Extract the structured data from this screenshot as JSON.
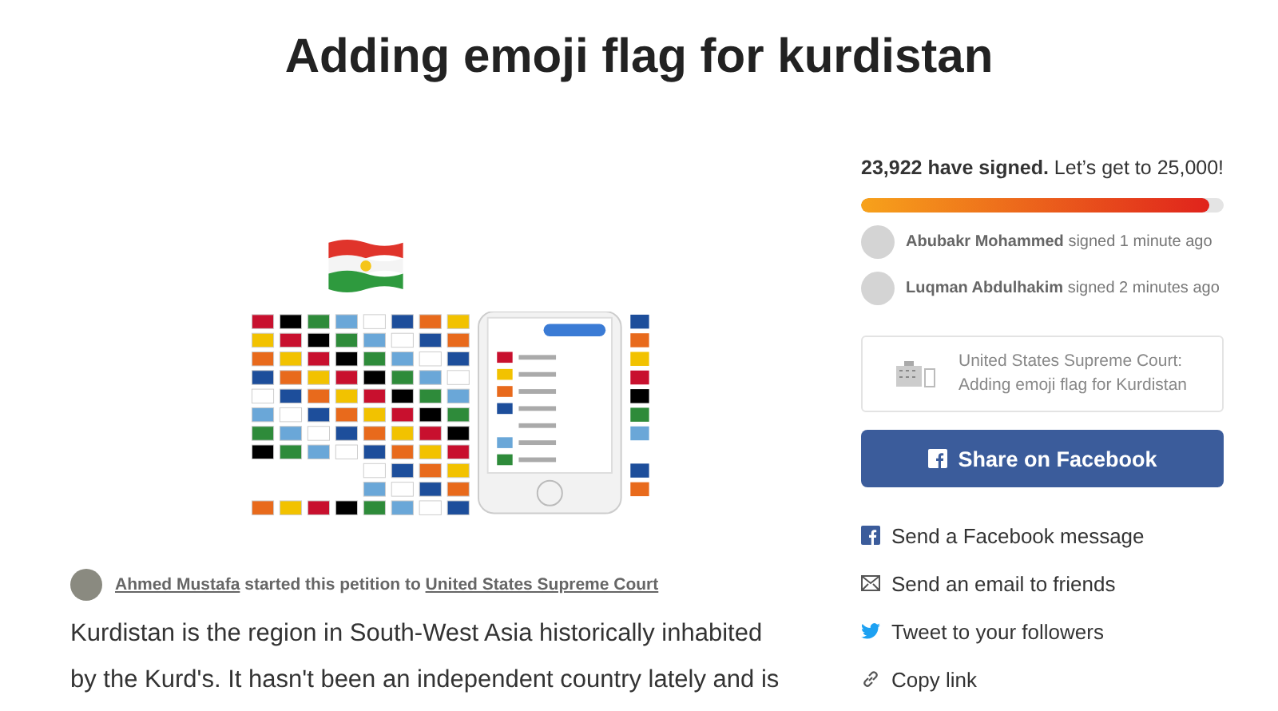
{
  "title": "Adding emoji flag for kurdistan",
  "signatures": {
    "count": "23,922 have signed.",
    "goal": "Let’s get to 25,000!",
    "level": 0.96
  },
  "recent_signers": [
    {
      "name": "Abubakr Mohammed",
      "action": "signed 1 minute ago"
    },
    {
      "name": "Luqman Abdulhakim",
      "action": "signed 2 minutes ago"
    }
  ],
  "share_card": {
    "line_1": "United States Supreme Court:",
    "line_2": "Adding emoji flag for Kurdistan"
  },
  "share_button": "Share on Facebook",
  "share_links": [
    {
      "kind": "facebook",
      "label": "Send a Facebook message"
    },
    {
      "kind": "email",
      "label": "Send an email to friends"
    },
    {
      "kind": "twitter",
      "label": "Tweet to your followers"
    },
    {
      "kind": "link",
      "label": "Copy link"
    }
  ],
  "starter": {
    "name": "Ahmed Mustafa",
    "text": "started this petition to",
    "target": "United States Supreme Court"
  },
  "body_lines": [
    "Kurdistan is the region in South-West Asia historically inhabited",
    "by the Kurd's. It hasn't been an independent country lately and is"
  ]
}
